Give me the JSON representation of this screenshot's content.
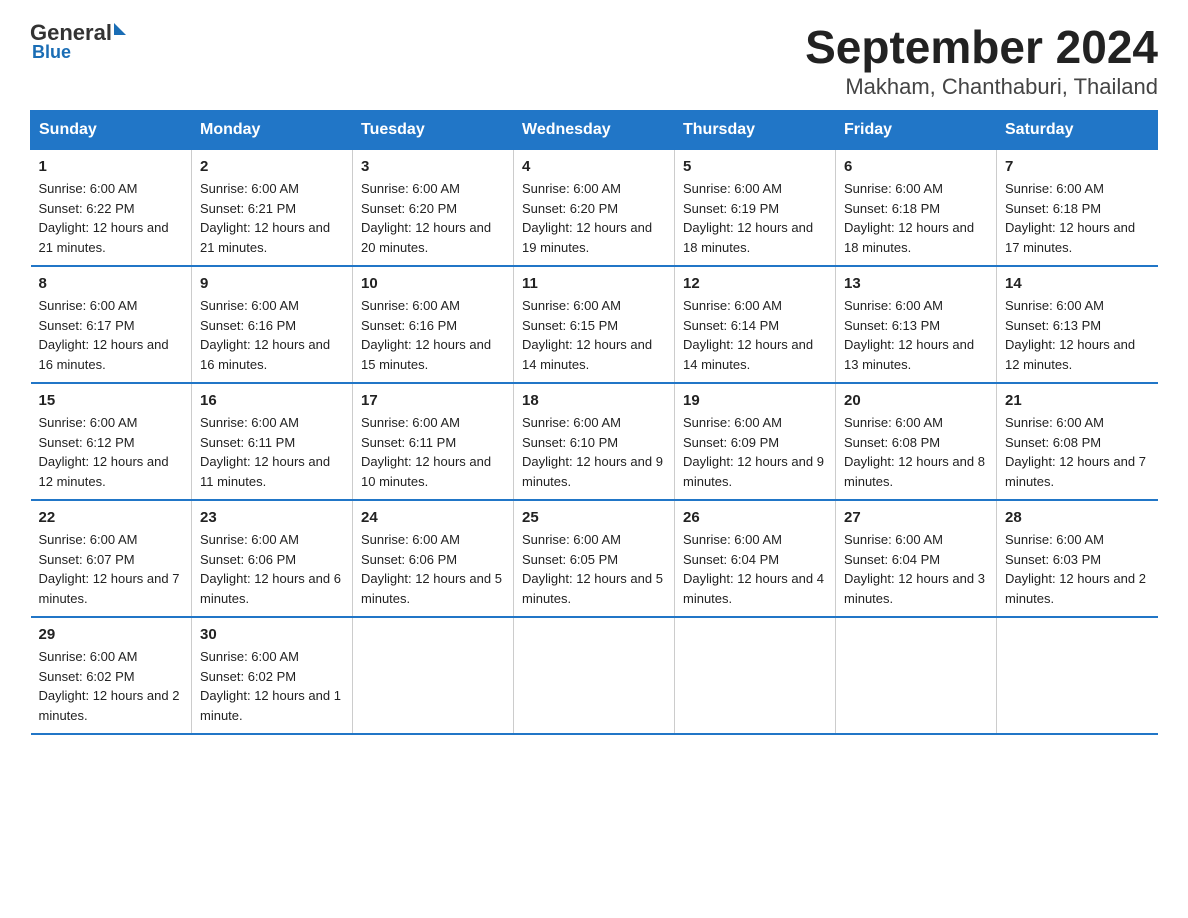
{
  "logo": {
    "text": "General",
    "blue_text": "Blue"
  },
  "title": "September 2024",
  "subtitle": "Makham, Chanthaburi, Thailand",
  "days_of_week": [
    "Sunday",
    "Monday",
    "Tuesday",
    "Wednesday",
    "Thursday",
    "Friday",
    "Saturday"
  ],
  "weeks": [
    [
      {
        "day": "1",
        "sunrise": "6:00 AM",
        "sunset": "6:22 PM",
        "daylight": "12 hours and 21 minutes."
      },
      {
        "day": "2",
        "sunrise": "6:00 AM",
        "sunset": "6:21 PM",
        "daylight": "12 hours and 21 minutes."
      },
      {
        "day": "3",
        "sunrise": "6:00 AM",
        "sunset": "6:20 PM",
        "daylight": "12 hours and 20 minutes."
      },
      {
        "day": "4",
        "sunrise": "6:00 AM",
        "sunset": "6:20 PM",
        "daylight": "12 hours and 19 minutes."
      },
      {
        "day": "5",
        "sunrise": "6:00 AM",
        "sunset": "6:19 PM",
        "daylight": "12 hours and 18 minutes."
      },
      {
        "day": "6",
        "sunrise": "6:00 AM",
        "sunset": "6:18 PM",
        "daylight": "12 hours and 18 minutes."
      },
      {
        "day": "7",
        "sunrise": "6:00 AM",
        "sunset": "6:18 PM",
        "daylight": "12 hours and 17 minutes."
      }
    ],
    [
      {
        "day": "8",
        "sunrise": "6:00 AM",
        "sunset": "6:17 PM",
        "daylight": "12 hours and 16 minutes."
      },
      {
        "day": "9",
        "sunrise": "6:00 AM",
        "sunset": "6:16 PM",
        "daylight": "12 hours and 16 minutes."
      },
      {
        "day": "10",
        "sunrise": "6:00 AM",
        "sunset": "6:16 PM",
        "daylight": "12 hours and 15 minutes."
      },
      {
        "day": "11",
        "sunrise": "6:00 AM",
        "sunset": "6:15 PM",
        "daylight": "12 hours and 14 minutes."
      },
      {
        "day": "12",
        "sunrise": "6:00 AM",
        "sunset": "6:14 PM",
        "daylight": "12 hours and 14 minutes."
      },
      {
        "day": "13",
        "sunrise": "6:00 AM",
        "sunset": "6:13 PM",
        "daylight": "12 hours and 13 minutes."
      },
      {
        "day": "14",
        "sunrise": "6:00 AM",
        "sunset": "6:13 PM",
        "daylight": "12 hours and 12 minutes."
      }
    ],
    [
      {
        "day": "15",
        "sunrise": "6:00 AM",
        "sunset": "6:12 PM",
        "daylight": "12 hours and 12 minutes."
      },
      {
        "day": "16",
        "sunrise": "6:00 AM",
        "sunset": "6:11 PM",
        "daylight": "12 hours and 11 minutes."
      },
      {
        "day": "17",
        "sunrise": "6:00 AM",
        "sunset": "6:11 PM",
        "daylight": "12 hours and 10 minutes."
      },
      {
        "day": "18",
        "sunrise": "6:00 AM",
        "sunset": "6:10 PM",
        "daylight": "12 hours and 9 minutes."
      },
      {
        "day": "19",
        "sunrise": "6:00 AM",
        "sunset": "6:09 PM",
        "daylight": "12 hours and 9 minutes."
      },
      {
        "day": "20",
        "sunrise": "6:00 AM",
        "sunset": "6:08 PM",
        "daylight": "12 hours and 8 minutes."
      },
      {
        "day": "21",
        "sunrise": "6:00 AM",
        "sunset": "6:08 PM",
        "daylight": "12 hours and 7 minutes."
      }
    ],
    [
      {
        "day": "22",
        "sunrise": "6:00 AM",
        "sunset": "6:07 PM",
        "daylight": "12 hours and 7 minutes."
      },
      {
        "day": "23",
        "sunrise": "6:00 AM",
        "sunset": "6:06 PM",
        "daylight": "12 hours and 6 minutes."
      },
      {
        "day": "24",
        "sunrise": "6:00 AM",
        "sunset": "6:06 PM",
        "daylight": "12 hours and 5 minutes."
      },
      {
        "day": "25",
        "sunrise": "6:00 AM",
        "sunset": "6:05 PM",
        "daylight": "12 hours and 5 minutes."
      },
      {
        "day": "26",
        "sunrise": "6:00 AM",
        "sunset": "6:04 PM",
        "daylight": "12 hours and 4 minutes."
      },
      {
        "day": "27",
        "sunrise": "6:00 AM",
        "sunset": "6:04 PM",
        "daylight": "12 hours and 3 minutes."
      },
      {
        "day": "28",
        "sunrise": "6:00 AM",
        "sunset": "6:03 PM",
        "daylight": "12 hours and 2 minutes."
      }
    ],
    [
      {
        "day": "29",
        "sunrise": "6:00 AM",
        "sunset": "6:02 PM",
        "daylight": "12 hours and 2 minutes."
      },
      {
        "day": "30",
        "sunrise": "6:00 AM",
        "sunset": "6:02 PM",
        "daylight": "12 hours and 1 minute."
      },
      null,
      null,
      null,
      null,
      null
    ]
  ],
  "labels": {
    "sunrise": "Sunrise:",
    "sunset": "Sunset:",
    "daylight": "Daylight:"
  }
}
